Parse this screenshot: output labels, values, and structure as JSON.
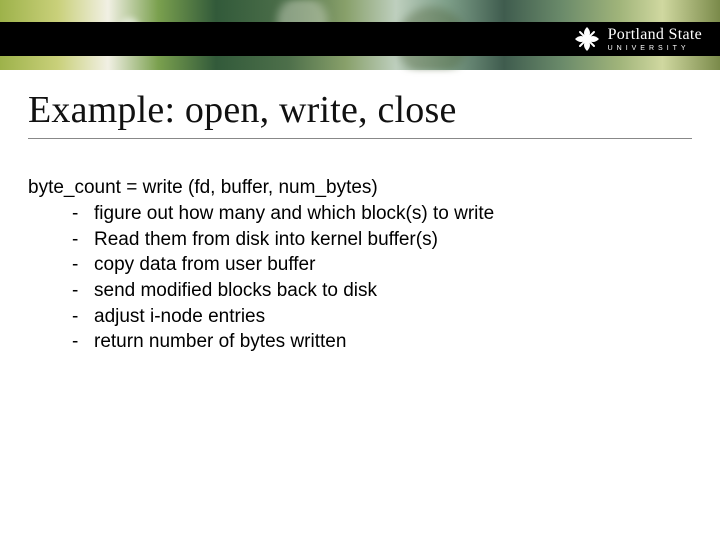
{
  "brand": {
    "name": "Portland State",
    "sub": "UNIVERSITY"
  },
  "slide": {
    "title": "Example: open, write, close",
    "code_line": "byte_count = write (fd, buffer, num_bytes)",
    "bullets": [
      "figure out how many and which block(s) to write",
      "Read them from disk into kernel buffer(s)",
      "copy data from user buffer",
      "send modified blocks back to disk",
      "adjust i-node entries",
      "return number of bytes written"
    ]
  }
}
